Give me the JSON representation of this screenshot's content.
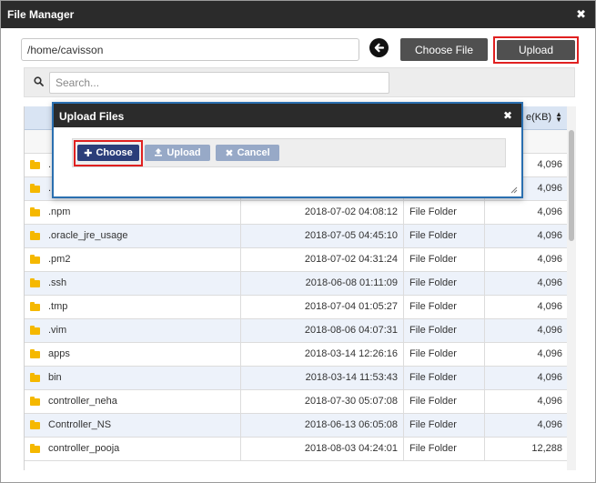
{
  "window": {
    "title": "File Manager",
    "close_glyph": "✖"
  },
  "toolbar": {
    "path_value": "/home/cavisson",
    "back_icon": "arrow-left-circle-icon",
    "choose_file_label": "Choose File",
    "upload_label": "Upload"
  },
  "search": {
    "placeholder": "Search...",
    "value": ""
  },
  "table": {
    "size_header": "e(KB)",
    "rows": [
      {
        "name": ".",
        "date": "",
        "type": "",
        "size": "4,096"
      },
      {
        "name": ".",
        "date": "",
        "type": "",
        "size": "4,096"
      },
      {
        "name": ".npm",
        "date": "2018-07-02 04:08:12",
        "type": "File Folder",
        "size": "4,096"
      },
      {
        "name": ".oracle_jre_usage",
        "date": "2018-07-05 04:45:10",
        "type": "File Folder",
        "size": "4,096"
      },
      {
        "name": ".pm2",
        "date": "2018-07-02 04:31:24",
        "type": "File Folder",
        "size": "4,096"
      },
      {
        "name": ".ssh",
        "date": "2018-06-08 01:11:09",
        "type": "File Folder",
        "size": "4,096"
      },
      {
        "name": ".tmp",
        "date": "2018-07-04 01:05:27",
        "type": "File Folder",
        "size": "4,096"
      },
      {
        "name": ".vim",
        "date": "2018-08-06 04:07:31",
        "type": "File Folder",
        "size": "4,096"
      },
      {
        "name": "apps",
        "date": "2018-03-14 12:26:16",
        "type": "File Folder",
        "size": "4,096"
      },
      {
        "name": "bin",
        "date": "2018-03-14 11:53:43",
        "type": "File Folder",
        "size": "4,096"
      },
      {
        "name": "controller_neha",
        "date": "2018-07-30 05:07:08",
        "type": "File Folder",
        "size": "4,096"
      },
      {
        "name": "Controller_NS",
        "date": "2018-06-13 06:05:08",
        "type": "File Folder",
        "size": "4,096"
      },
      {
        "name": "controller_pooja",
        "date": "2018-08-03 04:24:01",
        "type": "File Folder",
        "size": "12,288"
      }
    ]
  },
  "upload_dialog": {
    "title": "Upload Files",
    "close_glyph": "✖",
    "choose_label": "Choose",
    "upload_label": "Upload",
    "cancel_label": "Cancel"
  },
  "colors": {
    "titlebar": "#2b2b2b",
    "button_dark": "#505050",
    "highlight_border": "#e02020",
    "choose_btn": "#2b3e7a",
    "disabled_btn": "#97a9c7",
    "folder": "#f5b800",
    "row_alt": "#edf2fa",
    "header_bg": "#d9e4f3"
  }
}
